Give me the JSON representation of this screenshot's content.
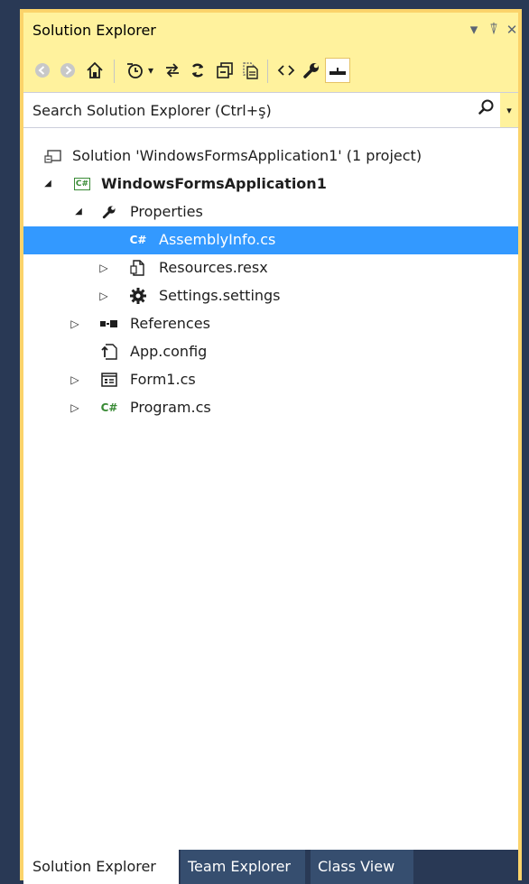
{
  "window": {
    "title": "Solution Explorer",
    "dropdown_icon": "▾",
    "pin_icon": "⍒",
    "close_icon": "✕"
  },
  "toolbar": {
    "buttons": [
      {
        "name": "back-icon",
        "glyph": "◀"
      },
      {
        "name": "forward-icon",
        "glyph": "▶"
      },
      {
        "name": "home-icon",
        "glyph": "⌂"
      },
      {
        "name": "pending-changes-filter-icon",
        "glyph": "◷"
      },
      {
        "name": "sync-with-active-document-icon",
        "glyph": "⇄"
      },
      {
        "name": "refresh-icon",
        "glyph": "↻"
      },
      {
        "name": "collapse-all-icon",
        "glyph": "⊟"
      },
      {
        "name": "show-all-files-icon",
        "glyph": "☷"
      },
      {
        "name": "view-code-icon",
        "glyph": "‹›"
      },
      {
        "name": "properties-icon",
        "glyph": "⚒"
      },
      {
        "name": "preview-selected-items-icon",
        "glyph": "▬"
      }
    ]
  },
  "search": {
    "placeholder": "Search Solution Explorer (Ctrl+ş)",
    "search_icon": "⌕",
    "dropdown_icon": "▾"
  },
  "tree": {
    "items": [
      {
        "label": "Solution 'WindowsFormsApplication1' (1 project)",
        "icon": "solution-icon",
        "expander": ""
      },
      {
        "label": "WindowsFormsApplication1",
        "icon": "csharp-project-icon",
        "expander": "◢"
      },
      {
        "label": "Properties",
        "icon": "wrench-icon",
        "expander": "◢"
      },
      {
        "label": "AssemblyInfo.cs",
        "icon": "csharp-file-icon",
        "expander": "",
        "selected": true
      },
      {
        "label": "Resources.resx",
        "icon": "resource-file-icon",
        "expander": "▷"
      },
      {
        "label": "Settings.settings",
        "icon": "settings-gear-icon",
        "expander": "▷"
      },
      {
        "label": "References",
        "icon": "references-icon",
        "expander": "▷"
      },
      {
        "label": "App.config",
        "icon": "config-file-icon",
        "expander": ""
      },
      {
        "label": "Form1.cs",
        "icon": "form-icon",
        "expander": "▷"
      },
      {
        "label": "Program.cs",
        "icon": "csharp-file-icon",
        "expander": "▷"
      }
    ]
  },
  "tabs": [
    {
      "label": "Solution Explorer",
      "active": true
    },
    {
      "label": "Team Explorer",
      "active": false
    },
    {
      "label": "Class View",
      "active": false
    }
  ],
  "colors": {
    "accent": "#fff29d",
    "frame_border": "#fbd36a",
    "selection": "#3399ff",
    "csharp_green": "#388a34",
    "tab_strip": "#293955"
  }
}
